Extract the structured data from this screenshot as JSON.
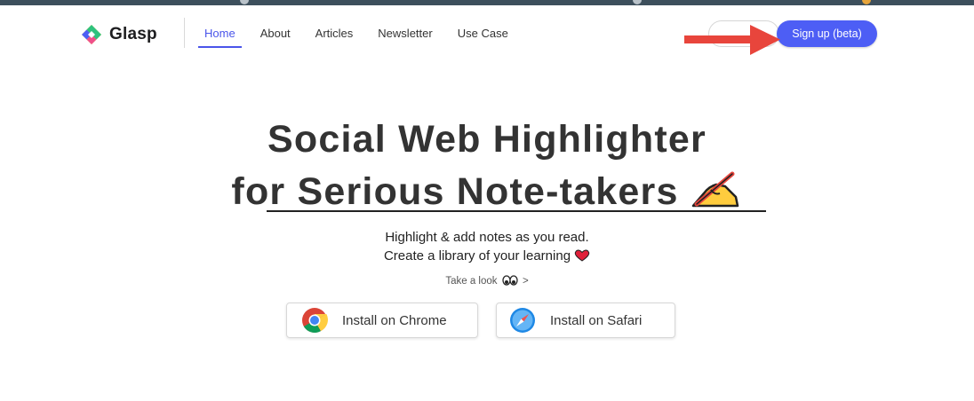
{
  "brand": {
    "name": "Glasp"
  },
  "nav": {
    "items": [
      {
        "label": "Home",
        "active": true
      },
      {
        "label": "About",
        "active": false
      },
      {
        "label": "Articles",
        "active": false
      },
      {
        "label": "Newsletter",
        "active": false
      },
      {
        "label": "Use Case",
        "active": false
      }
    ]
  },
  "header": {
    "signup_label": "Sign up (beta)"
  },
  "hero": {
    "title_line1": "Social Web Highlighter",
    "title_line2_prefix": "for ",
    "title_line2_emphasis": "Serious Note-takers",
    "subtitle_line1": "Highlight & add notes as you read.",
    "subtitle_line2": "Create a library of your learning",
    "take_look_prefix": "Take a look",
    "take_look_suffix": ">"
  },
  "install": {
    "chrome_label": "Install on Chrome",
    "safari_label": "Install on Safari"
  },
  "colors": {
    "accent": "#4d5ef5",
    "annotation_arrow": "#e8453c",
    "heart": "#e0213a"
  },
  "icons": [
    "glasp-logo-icon",
    "red-arrow-annotation",
    "writing-hand-icon",
    "heart-icon",
    "eyes-icon",
    "chrome-icon",
    "safari-icon"
  ]
}
